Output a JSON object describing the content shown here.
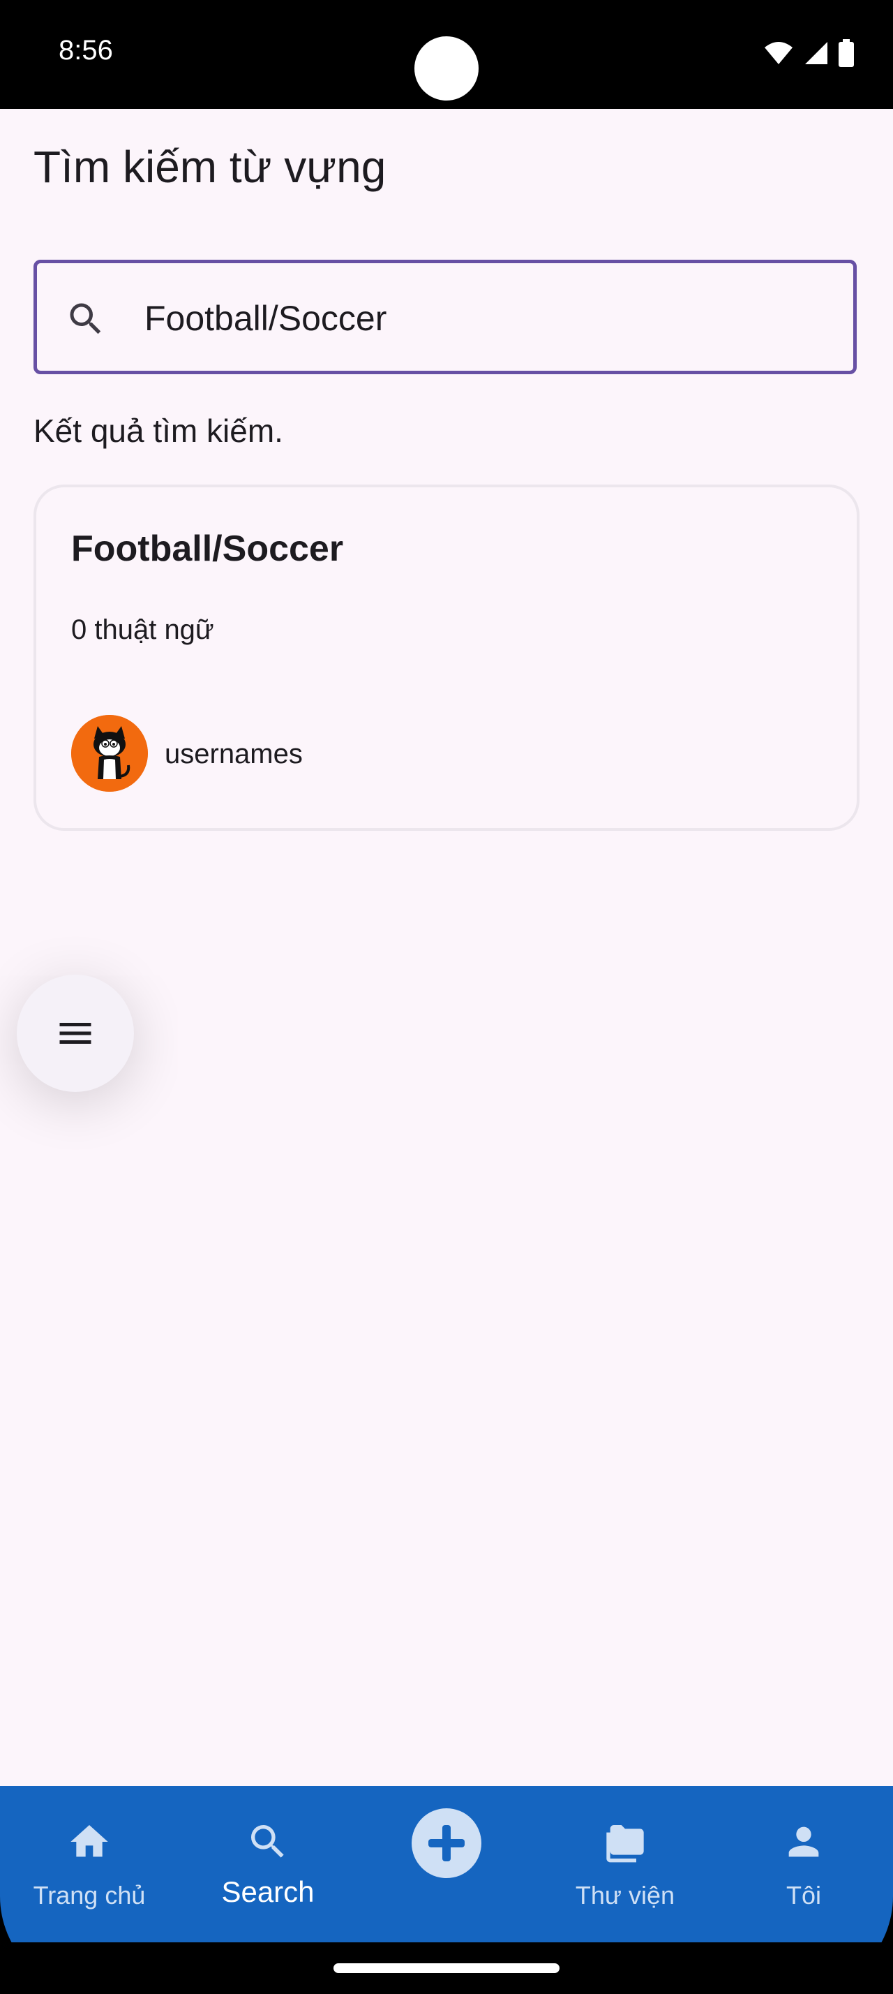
{
  "status_bar": {
    "time": "8:56"
  },
  "page": {
    "title": "Tìm kiếm từ vựng"
  },
  "search": {
    "value": "Football/Soccer"
  },
  "results": {
    "label": "Kết quả tìm kiếm.",
    "items": [
      {
        "title": "Football/Soccer",
        "count": "0 thuật ngữ",
        "username": "usernames"
      }
    ]
  },
  "bottom_nav": {
    "items": [
      {
        "label": "Trang chủ",
        "icon": "home-icon"
      },
      {
        "label": "Search",
        "icon": "search-icon",
        "active": true
      },
      {
        "label": "",
        "icon": "add-icon"
      },
      {
        "label": "Thư viện",
        "icon": "folder-icon"
      },
      {
        "label": "Tôi",
        "icon": "person-icon"
      }
    ]
  },
  "colors": {
    "accent": "#6750a4",
    "nav_background": "#1565c0",
    "screen_background": "#fcf5fb",
    "avatar_background": "#f26a0f"
  }
}
